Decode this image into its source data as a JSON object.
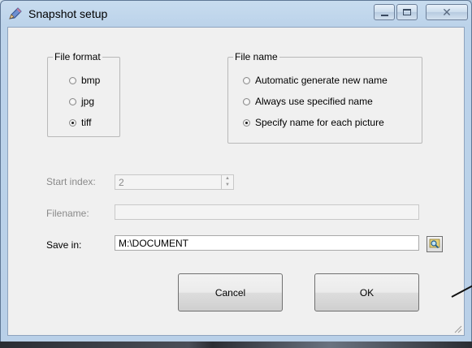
{
  "window": {
    "title": "Snapshot setup",
    "minimize_glyph": "",
    "close_glyph": "✕"
  },
  "file_format": {
    "label": "File format",
    "options": [
      {
        "label": "bmp",
        "checked": false
      },
      {
        "label": "jpg",
        "checked": false
      },
      {
        "label": "tiff",
        "checked": true
      }
    ]
  },
  "file_name": {
    "label": "File name",
    "options": [
      {
        "label": "Automatic generate new name",
        "checked": false
      },
      {
        "label": "Always use specified name",
        "checked": false
      },
      {
        "label": "Specify name for each picture",
        "checked": true
      }
    ]
  },
  "start_index": {
    "label": "Start index:",
    "value": "2",
    "enabled": false
  },
  "filename": {
    "label": "Filename:",
    "value": "",
    "enabled": false
  },
  "save_in": {
    "label": "Save in:",
    "value": "M:\\DOCUMENT",
    "browse_icon": "folder-search-icon"
  },
  "buttons": {
    "cancel": "Cancel",
    "ok": "OK"
  }
}
